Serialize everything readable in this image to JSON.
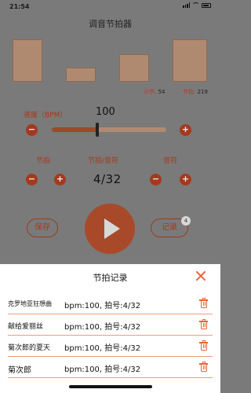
{
  "status_bar": {
    "time": "21:54",
    "icons": [
      "signal-icon",
      "wifi-icon",
      "battery-icon"
    ]
  },
  "app": {
    "title": "调音节拍器"
  },
  "bar_info": {
    "bar_label": "小节:",
    "bar_value": "54",
    "beat_label": "节拍:",
    "beat_value": "219"
  },
  "speed": {
    "label": "速度（BPM）",
    "value": "100",
    "slider_fraction": 0.4,
    "minus": "−",
    "plus": "+"
  },
  "signature": {
    "beat_label": "节拍",
    "center_label": "节拍/音符",
    "note_label": "音符",
    "value": "4/32",
    "minus": "−",
    "plus": "+"
  },
  "actions": {
    "save_label": "保存",
    "record_label": "记录",
    "record_badge": "4",
    "play_icon": "play-icon"
  },
  "sheet": {
    "title": "节拍记录",
    "close_icon": "close-icon",
    "delete_icon": "trash-icon",
    "records": [
      {
        "name": "克罗地亚狂想曲",
        "detail": "bpm:100, 拍号:4/32"
      },
      {
        "name": "献给爱丽丝",
        "detail": "bpm:100, 拍号:4/32"
      },
      {
        "name": "菊次郎的夏天",
        "detail": "bpm:100, 拍号:4/32"
      },
      {
        "name": "菊次郎",
        "detail": "bpm:100, 拍号:4/32"
      }
    ]
  },
  "colors": {
    "accent": "#e8643a",
    "overlay": "#7a7a7a",
    "beat_block": "#b08a70"
  }
}
